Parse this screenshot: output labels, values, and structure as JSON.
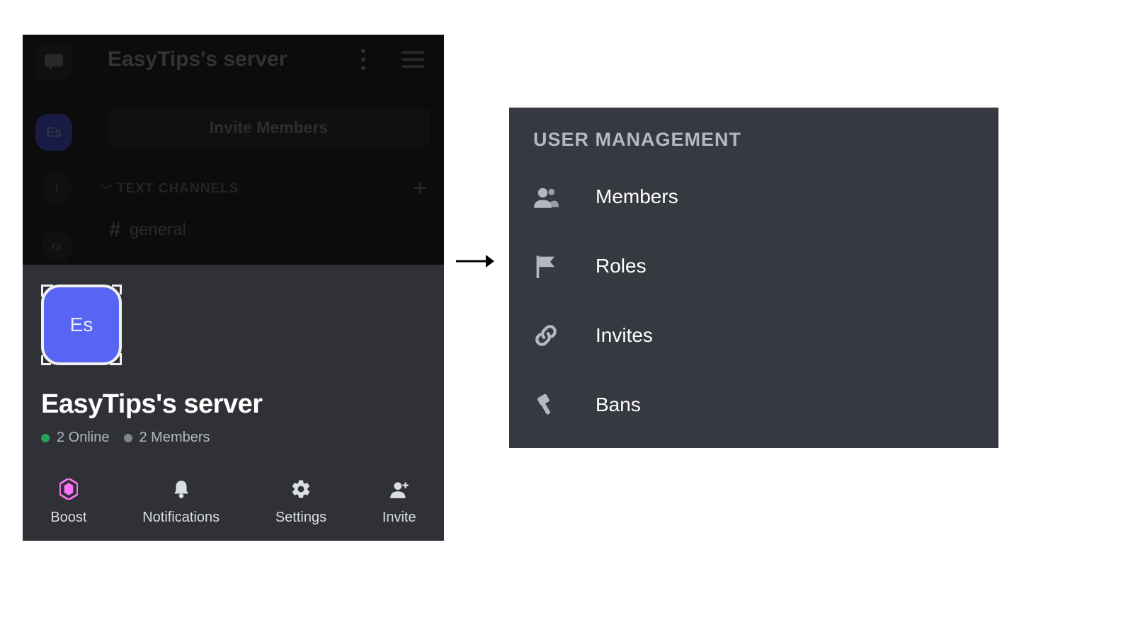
{
  "header": {
    "server_name": "EasyTips's server"
  },
  "rail": {
    "es_label": "Es",
    "c1_label": "|",
    "c2_label": "rs"
  },
  "channels": {
    "invite_button": "Invite Members",
    "section_label": "TEXT CHANNELS",
    "items": [
      {
        "name": "general"
      }
    ]
  },
  "sheet": {
    "icon_text": "Es",
    "server_name": "EasyTips's server",
    "online_text": "2 Online",
    "members_text": "2 Members"
  },
  "actions": {
    "boost": "Boost",
    "notifications": "Notifications",
    "settings": "Settings",
    "invite": "Invite"
  },
  "user_management": {
    "title": "USER MANAGEMENT",
    "items": [
      {
        "label": "Members"
      },
      {
        "label": "Roles"
      },
      {
        "label": "Invites"
      },
      {
        "label": "Bans"
      }
    ]
  }
}
